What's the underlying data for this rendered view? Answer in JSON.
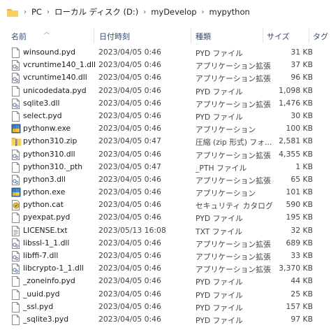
{
  "address": {
    "crumbs": [
      "PC",
      "ローカル ディスク (D:)",
      "myDevelop",
      "mypython"
    ],
    "separator": "›"
  },
  "columns": {
    "name": "名前",
    "date": "日付時刻",
    "type": "種類",
    "size": "サイズ",
    "tags": "タグ"
  },
  "files": [
    {
      "name": "winsound.pyd",
      "date": "2023/04/05 0:46",
      "type": "PYD ファイル",
      "size": "31 KB",
      "icon": "file-icon"
    },
    {
      "name": "vcruntime140_1.dll",
      "date": "2023/04/05 0:46",
      "type": "アプリケーション拡張",
      "size": "37 KB",
      "icon": "dll-icon"
    },
    {
      "name": "vcruntime140.dll",
      "date": "2023/04/05 0:46",
      "type": "アプリケーション拡張",
      "size": "96 KB",
      "icon": "dll-icon"
    },
    {
      "name": "unicodedata.pyd",
      "date": "2023/04/05 0:46",
      "type": "PYD ファイル",
      "size": "1,098 KB",
      "icon": "file-icon"
    },
    {
      "name": "sqlite3.dll",
      "date": "2023/04/05 0:46",
      "type": "アプリケーション拡張",
      "size": "1,476 KB",
      "icon": "dll-icon"
    },
    {
      "name": "select.pyd",
      "date": "2023/04/05 0:46",
      "type": "PYD ファイル",
      "size": "30 KB",
      "icon": "file-icon"
    },
    {
      "name": "pythonw.exe",
      "date": "2023/04/05 0:46",
      "type": "アプリケーション",
      "size": "100 KB",
      "icon": "python-exe-icon"
    },
    {
      "name": "python310.zip",
      "date": "2023/04/05 0:47",
      "type": "圧縮 (zip 形式) フォ...",
      "size": "2,581 KB",
      "icon": "zip-icon"
    },
    {
      "name": "python310.dll",
      "date": "2023/04/05 0:46",
      "type": "アプリケーション拡張",
      "size": "4,355 KB",
      "icon": "dll-icon"
    },
    {
      "name": "python310._pth",
      "date": "2023/04/05 0:47",
      "type": "_PTH ファイル",
      "size": "1 KB",
      "icon": "file-icon"
    },
    {
      "name": "python3.dll",
      "date": "2023/04/05 0:46",
      "type": "アプリケーション拡張",
      "size": "65 KB",
      "icon": "dll-icon"
    },
    {
      "name": "python.exe",
      "date": "2023/04/05 0:46",
      "type": "アプリケーション",
      "size": "101 KB",
      "icon": "python-exe-icon"
    },
    {
      "name": "python.cat",
      "date": "2023/04/05 0:46",
      "type": "セキュリティ カタログ",
      "size": "590 KB",
      "icon": "catalog-icon"
    },
    {
      "name": "pyexpat.pyd",
      "date": "2023/04/05 0:46",
      "type": "PYD ファイル",
      "size": "195 KB",
      "icon": "file-icon"
    },
    {
      "name": "LICENSE.txt",
      "date": "2023/05/13 16:08",
      "type": "TXT ファイル",
      "size": "32 KB",
      "icon": "text-file-icon"
    },
    {
      "name": "libssl-1_1.dll",
      "date": "2023/04/05 0:46",
      "type": "アプリケーション拡張",
      "size": "689 KB",
      "icon": "dll-icon"
    },
    {
      "name": "libffi-7.dll",
      "date": "2023/04/05 0:46",
      "type": "アプリケーション拡張",
      "size": "33 KB",
      "icon": "dll-icon"
    },
    {
      "name": "libcrypto-1_1.dll",
      "date": "2023/04/05 0:46",
      "type": "アプリケーション拡張",
      "size": "3,370 KB",
      "icon": "dll-icon"
    },
    {
      "name": "_zoneinfo.pyd",
      "date": "2023/04/05 0:46",
      "type": "PYD ファイル",
      "size": "44 KB",
      "icon": "file-icon"
    },
    {
      "name": "_uuid.pyd",
      "date": "2023/04/05 0:46",
      "type": "PYD ファイル",
      "size": "25 KB",
      "icon": "file-icon"
    },
    {
      "name": "_ssl.pyd",
      "date": "2023/04/05 0:46",
      "type": "PYD ファイル",
      "size": "157 KB",
      "icon": "file-icon"
    },
    {
      "name": "_sqlite3.pyd",
      "date": "2023/04/05 0:46",
      "type": "PYD ファイル",
      "size": "97 KB",
      "icon": "file-icon"
    }
  ]
}
